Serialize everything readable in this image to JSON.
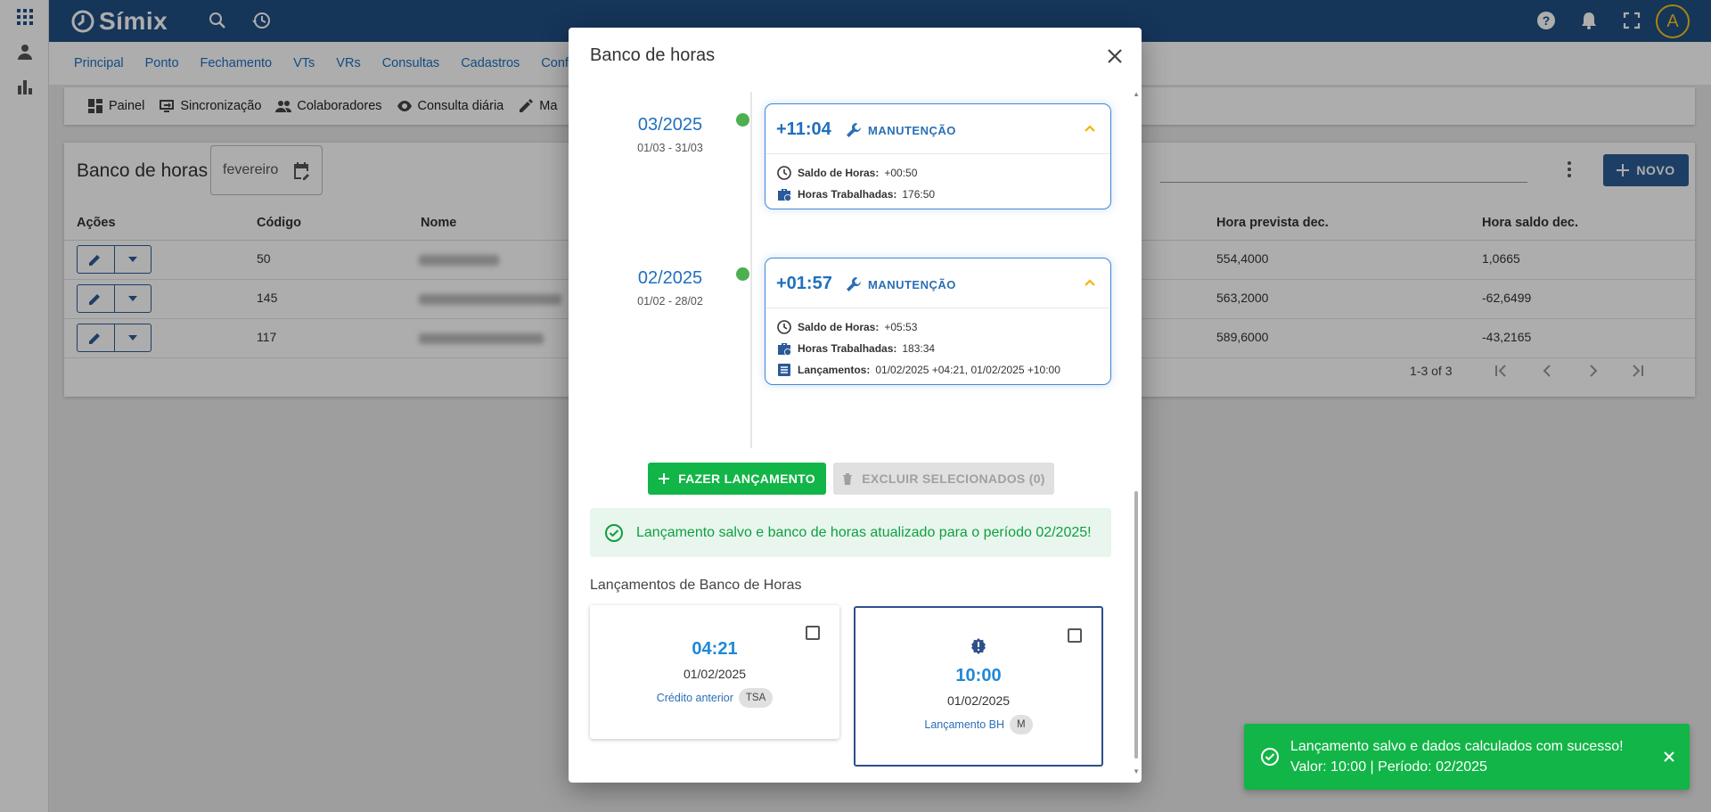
{
  "app": {
    "brand": "Símix",
    "avatar_letter": "A"
  },
  "menu": [
    "Principal",
    "Ponto",
    "Fechamento",
    "VTs",
    "VRs",
    "Consultas",
    "Cadastros",
    "Confi"
  ],
  "submenu": [
    "Painel",
    "Sincronização",
    "Colaboradores",
    "Consulta diária",
    "Ma"
  ],
  "page": {
    "title": "Banco de horas",
    "month": "fevereiro",
    "new_button": "NOVO",
    "columns": {
      "acoes": "Ações",
      "codigo": "Código",
      "nome": "Nome",
      "hora_prevista": "Hora prevista dec.",
      "hora_saldo": "Hora saldo dec."
    },
    "rows": [
      {
        "codigo": "50",
        "prevista": "554,4000",
        "saldo": "1,0665"
      },
      {
        "codigo": "145",
        "prevista": "563,2000",
        "saldo": "-62,6499"
      },
      {
        "codigo": "117",
        "prevista": "589,6000",
        "saldo": "-43,2165"
      }
    ],
    "pagination": "1-3 of 3"
  },
  "dialog": {
    "title": "Banco de horas",
    "periods": [
      {
        "period": "03/2025",
        "range": "01/03 - 31/03",
        "value": "+11:04",
        "tag": "MANUTENÇÃO",
        "saldo_label": "Saldo de Horas:",
        "saldo": "+00:50",
        "trab_label": "Horas Trabalhadas:",
        "trab": "176:50"
      },
      {
        "period": "02/2025",
        "range": "01/02 - 28/02",
        "value": "+01:57",
        "tag": "MANUTENÇÃO",
        "saldo_label": "Saldo de Horas:",
        "saldo": "+05:53",
        "trab_label": "Horas Trabalhadas:",
        "trab": "183:34",
        "lanc_label": "Lançamentos:",
        "lanc": "01/02/2025 +04:21, 01/02/2025 +10:00"
      }
    ],
    "btn_lancar": "FAZER LANÇAMENTO",
    "btn_excluir": "EXCLUIR SELECIONADOS (0)",
    "alert": "Lançamento salvo e banco de horas atualizado para o período 02/2025!",
    "lanc_title": "Lançamentos de Banco de Horas",
    "lancamentos": [
      {
        "value": "04:21",
        "date": "01/02/2025",
        "type": "Crédito anterior",
        "chip": "TSA"
      },
      {
        "value": "10:00",
        "date": "01/02/2025",
        "type": "Lançamento BH",
        "chip": "M"
      }
    ]
  },
  "snackbar": {
    "line1": "Lançamento salvo e dados calculados com sucesso!",
    "line2": "Valor: 10:00 | Período: 02/2025"
  },
  "colors": {
    "primary": "#1f4e84",
    "accent": "#1f6fbf",
    "success": "#12b547",
    "dot": "#4caf50"
  }
}
